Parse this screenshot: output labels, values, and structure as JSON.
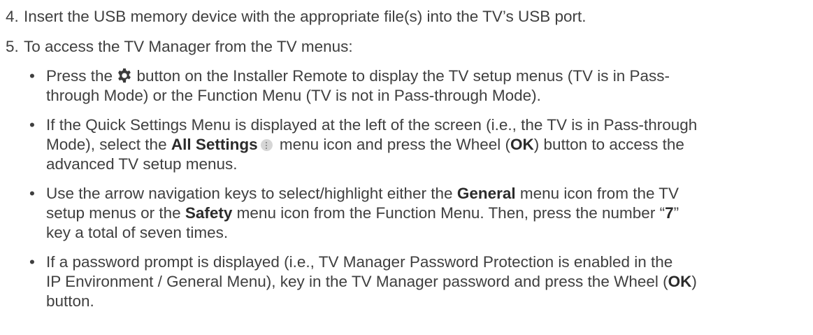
{
  "steps": [
    {
      "num": "4.",
      "text": "Insert the USB memory device with the appropriate file(s) into the TV’s USB port."
    },
    {
      "num": "5.",
      "text": "To access the TV Manager from the TV menus:"
    }
  ],
  "bullet_symbol": "•",
  "bullets": {
    "b1": {
      "l1_pre": "Press the ",
      "icon": "gear-icon",
      "l1_post": " button on the Installer Remote to display the TV setup menus (TV is in Pass-",
      "l2": "through Mode) or the Function Menu (TV is not in Pass-through Mode)."
    },
    "b2": {
      "l1": "If the Quick Settings Menu is displayed at the left of the screen (i.e., the TV is in Pass-through",
      "l2_pre": "Mode), select the ",
      "l2_bold": "All Settings",
      "icon": "more-vertical-icon",
      "l2_mid": " menu icon and press the Wheel (",
      "l2_ok": "OK",
      "l2_post": ") button to access the",
      "l3": "advanced TV setup menus."
    },
    "b3": {
      "l1_pre": "Use the arrow navigation keys to select/highlight either the ",
      "l1_bold": "General",
      "l1_post": " menu icon from the TV",
      "l2_pre": "setup menus or the ",
      "l2_bold": "Safety",
      "l2_mid": " menu icon from the Function Menu. Then, press the number “",
      "l2_seven": "7",
      "l2_post": "”",
      "l3": "key a total of seven times."
    },
    "b4": {
      "l1": "If a password prompt is displayed (i.e., TV Manager Password Protection is enabled in the",
      "l2_pre": "IP Environment / General Menu), key in the TV Manager password and press the Wheel (",
      "l2_ok": "OK",
      "l2_post": ")",
      "l3": "button."
    }
  }
}
